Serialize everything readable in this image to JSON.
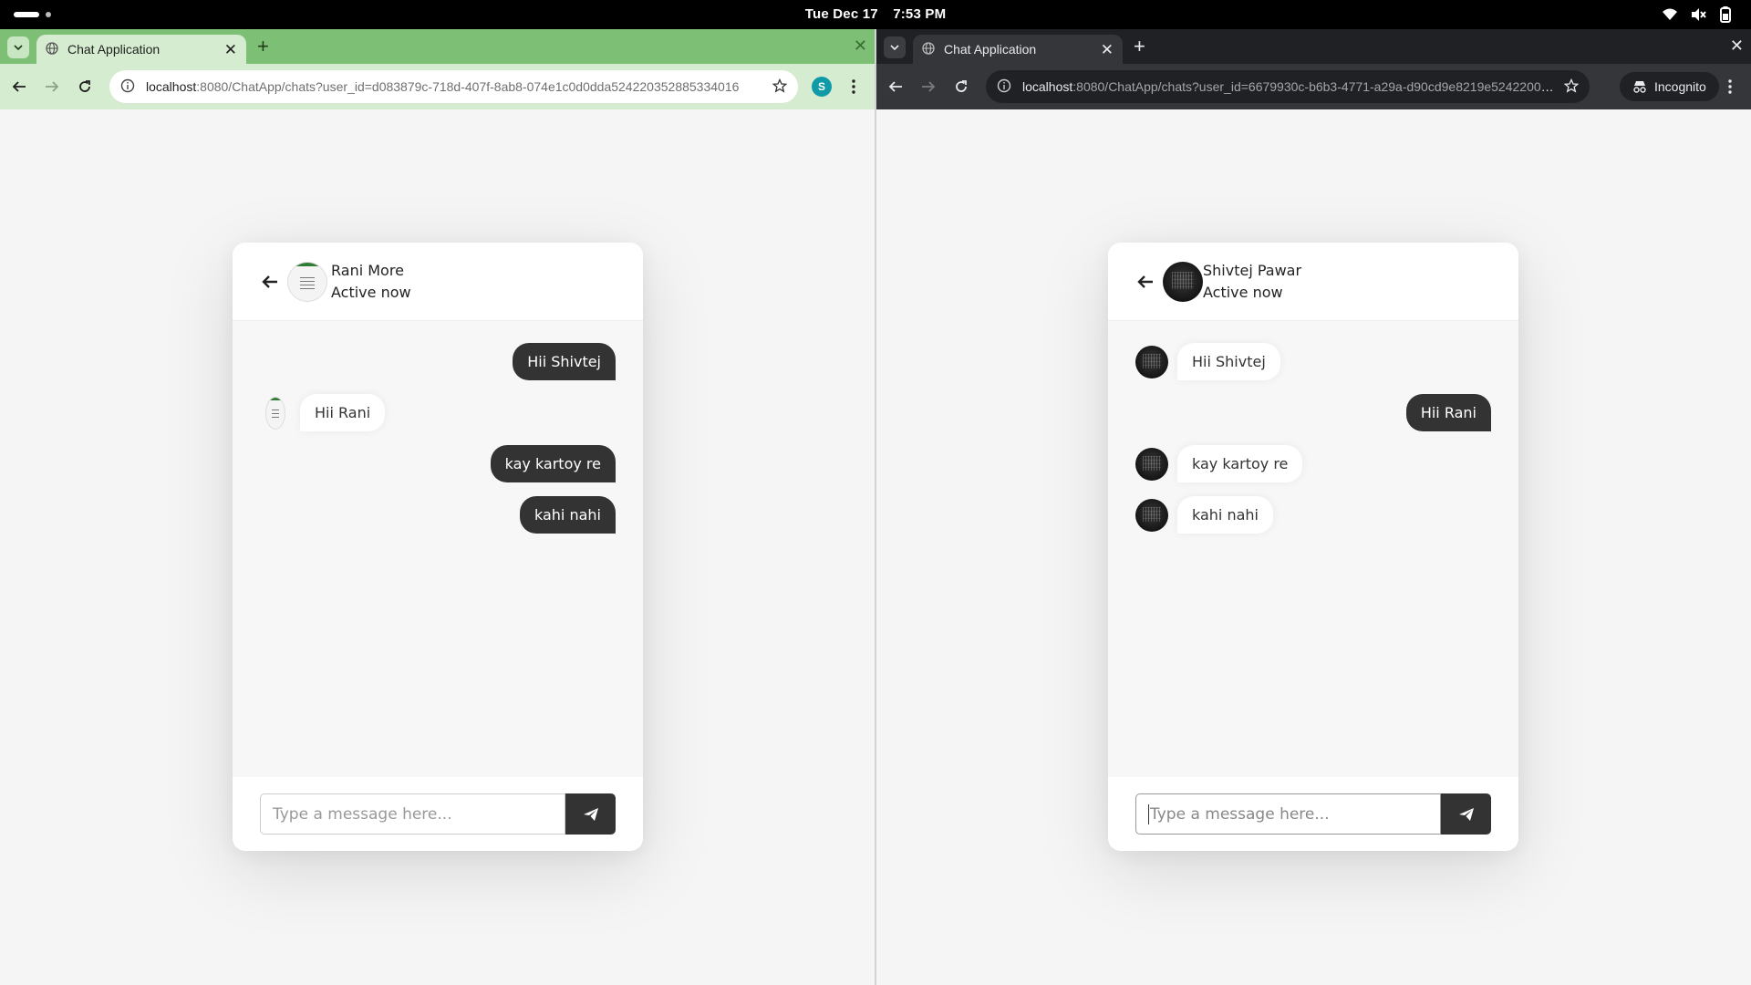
{
  "system": {
    "date": "Tue Dec 17",
    "time": "7:53 PM"
  },
  "left_window": {
    "tab_title": "Chat Application",
    "url_host": "localhost",
    "url_rest": ":8080/ChatApp/chats?user_id=d083879c-718d-407f-8ab8-074e1c0d0dda524220352885334016",
    "profile_initial": "S",
    "chat": {
      "contact_name": "Rani More",
      "status": "Active now",
      "messages": [
        {
          "dir": "out",
          "text": "Hii Shivtej"
        },
        {
          "dir": "in",
          "text": "Hii Rani"
        },
        {
          "dir": "out",
          "text": "kay kartoy re"
        },
        {
          "dir": "out",
          "text": "kahi nahi"
        }
      ],
      "input_placeholder": "Type a message here..."
    }
  },
  "right_window": {
    "tab_title": "Chat Application",
    "url_host": "localhost",
    "url_rest": ":8080/ChatApp/chats?user_id=6679930c-b6b3-4771-a29a-d90cd9e8219e524220058...",
    "incognito_label": "Incognito",
    "chat": {
      "contact_name": "Shivtej Pawar",
      "status": "Active now",
      "messages": [
        {
          "dir": "in",
          "text": "Hii Shivtej"
        },
        {
          "dir": "out",
          "text": "Hii Rani"
        },
        {
          "dir": "in",
          "text": "kay kartoy re"
        },
        {
          "dir": "in",
          "text": "kahi nahi"
        }
      ],
      "input_placeholder": "Type a message here..."
    }
  },
  "colors": {
    "left_tabstrip": "#7dbf75",
    "right_tabstrip": "#202124",
    "outgoing_bubble": "#333333",
    "page_background": "#f5f5f5"
  }
}
